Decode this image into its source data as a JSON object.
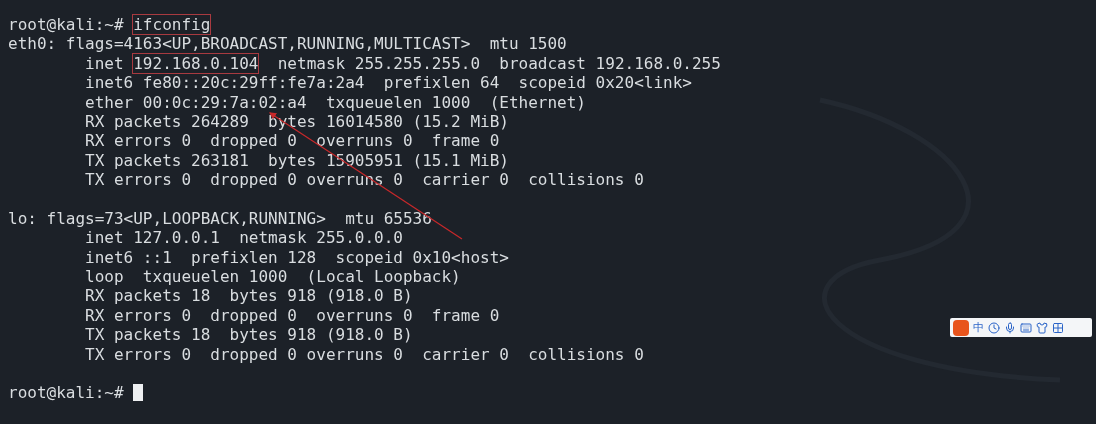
{
  "terminal": {
    "lines": [
      {
        "kind": "prompt",
        "prompt": "root@kali:~#",
        "command": "ifconfig",
        "highlighted": true
      },
      {
        "kind": "output",
        "text": "eth0: flags=4163<UP,BROADCAST,RUNNING,MULTICAST>  mtu 1500"
      },
      {
        "kind": "segments",
        "segments": [
          {
            "text": "        inet ",
            "highlighted": false
          },
          {
            "text": "192.168.0.104",
            "highlighted": true
          },
          {
            "text": "  netmask 255.255.255.0  broadcast 192.168.0.255",
            "highlighted": false
          }
        ]
      },
      {
        "kind": "output",
        "text": "        inet6 fe80::20c:29ff:fe7a:2a4  prefixlen 64  scopeid 0x20<link>"
      },
      {
        "kind": "output",
        "text": "        ether 00:0c:29:7a:02:a4  txqueuelen 1000  (Ethernet)"
      },
      {
        "kind": "output",
        "text": "        RX packets 264289  bytes 16014580 (15.2 MiB)"
      },
      {
        "kind": "output",
        "text": "        RX errors 0  dropped 0  overruns 0  frame 0"
      },
      {
        "kind": "output",
        "text": "        TX packets 263181  bytes 15905951 (15.1 MiB)"
      },
      {
        "kind": "output",
        "text": "        TX errors 0  dropped 0 overruns 0  carrier 0  collisions 0"
      },
      {
        "kind": "blank"
      },
      {
        "kind": "output",
        "text": "lo: flags=73<UP,LOOPBACK,RUNNING>  mtu 65536"
      },
      {
        "kind": "output",
        "text": "        inet 127.0.0.1  netmask 255.0.0.0"
      },
      {
        "kind": "output",
        "text": "        inet6 ::1  prefixlen 128  scopeid 0x10<host>"
      },
      {
        "kind": "output",
        "text": "        loop  txqueuelen 1000  (Local Loopback)"
      },
      {
        "kind": "output",
        "text": "        RX packets 18  bytes 918 (918.0 B)"
      },
      {
        "kind": "output",
        "text": "        RX errors 0  dropped 0  overruns 0  frame 0"
      },
      {
        "kind": "output",
        "text": "        TX packets 18  bytes 918 (918.0 B)"
      },
      {
        "kind": "output",
        "text": "        TX errors 0  dropped 0 overruns 0  carrier 0  collisions 0"
      },
      {
        "kind": "blank"
      },
      {
        "kind": "prompt",
        "prompt": "root@kali:~#",
        "cursor": true
      }
    ]
  },
  "annotations": [
    {
      "kind": "arrow"
    }
  ],
  "ime_toolbar": {
    "mode": "中"
  }
}
